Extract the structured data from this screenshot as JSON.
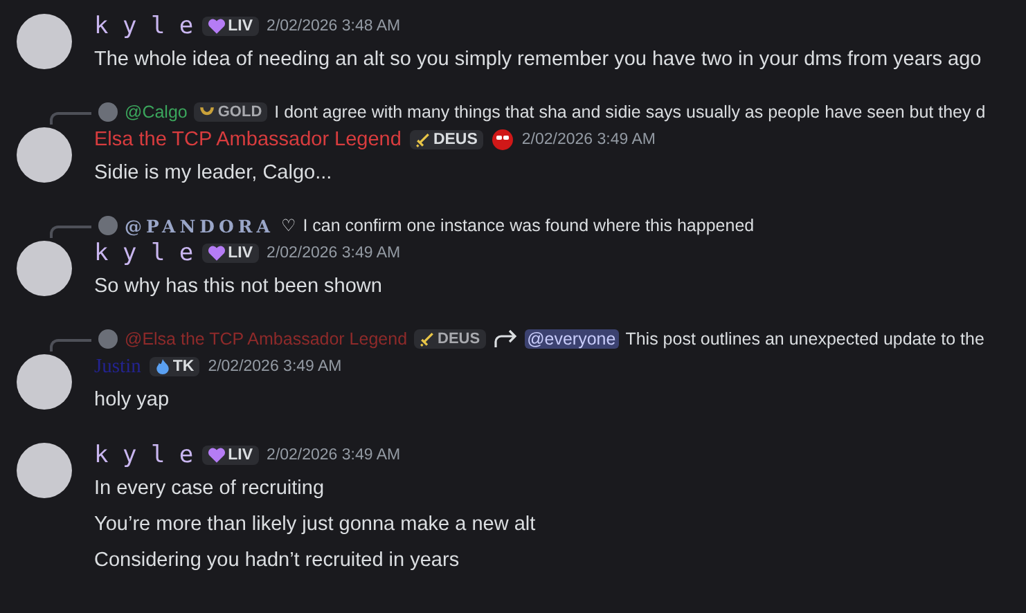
{
  "messages": [
    {
      "author": {
        "name": "k y l e",
        "color": "#c9b6f0",
        "kind": "mono"
      },
      "badge": {
        "kind": "heart",
        "label": "LIV"
      },
      "reaction_icon": false,
      "time": "2/02/2026 3:48 AM",
      "lines": [
        "The whole idea of needing an alt so you simply remember you have two in your dms from years ago"
      ]
    },
    {
      "reply": {
        "author": "@Calgo",
        "color": "#3ba55c",
        "kind": "plain",
        "badge": {
          "kind": "horseshoe",
          "label": "GOLD"
        },
        "forwarded": false,
        "text": "I dont agree with many things that sha and sidie says usually as people have seen but they d"
      },
      "author": {
        "name": "Elsa the TCP Ambassador Legend",
        "color": "#d83c3e",
        "kind": "plain"
      },
      "badge": {
        "kind": "sword",
        "label": "DEUS"
      },
      "reaction_icon": true,
      "time": "2/02/2026 3:49 AM",
      "lines": [
        "Sidie is my leader, Calgo..."
      ]
    },
    {
      "reply": {
        "author": "@PANDORA",
        "color": "#9aa6c8",
        "kind": "fancy",
        "symbol": "♡",
        "forwarded": false,
        "text": "I can confirm one instance was found where this happened"
      },
      "author": {
        "name": "k y l e",
        "color": "#c9b6f0",
        "kind": "mono"
      },
      "badge": {
        "kind": "heart",
        "label": "LIV"
      },
      "reaction_icon": false,
      "time": "2/02/2026 3:49 AM",
      "lines": [
        "So why has this not been shown"
      ]
    },
    {
      "reply": {
        "author": "@Elsa the TCP Ambassador Legend",
        "color": "#8e2a2a",
        "kind": "plain",
        "badge": {
          "kind": "sword",
          "label": "DEUS"
        },
        "forwarded": true,
        "mention": "@everyone",
        "text": "This post outlines an unexpected update to the"
      },
      "author": {
        "name": "Justin",
        "color": "#23238f",
        "kind": "serif"
      },
      "badge": {
        "kind": "flame",
        "label": "TK"
      },
      "reaction_icon": false,
      "time": "2/02/2026 3:49 AM",
      "lines": [
        "holy yap"
      ]
    },
    {
      "author": {
        "name": "k y l e",
        "color": "#c9b6f0",
        "kind": "mono"
      },
      "badge": {
        "kind": "heart",
        "label": "LIV"
      },
      "reaction_icon": false,
      "time": "2/02/2026 3:49 AM",
      "lines": [
        "In every case of recruiting",
        "You’re more than likely just gonna make a new alt",
        "Considering you hadn’t recruited in years"
      ]
    }
  ]
}
